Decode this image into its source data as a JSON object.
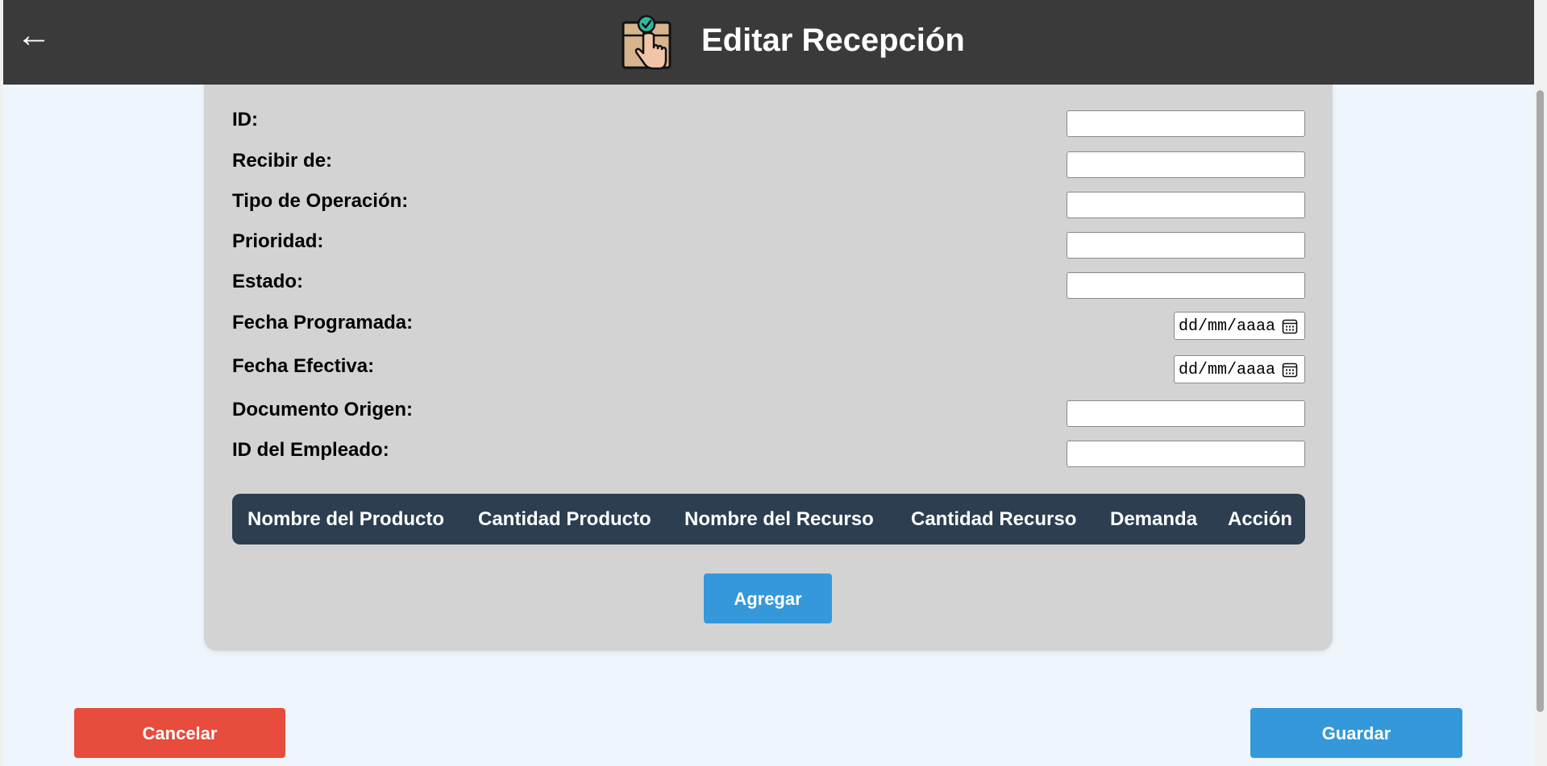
{
  "header": {
    "back_label": "←",
    "title": "Editar Recepción",
    "logo_icon": "package-pointer-icon"
  },
  "form": {
    "fields": [
      {
        "label": "ID:",
        "type": "text",
        "value": ""
      },
      {
        "label": "Recibir de:",
        "type": "text",
        "value": ""
      },
      {
        "label": "Tipo de Operación:",
        "type": "text",
        "value": ""
      },
      {
        "label": "Prioridad:",
        "type": "text",
        "value": ""
      },
      {
        "label": "Estado:",
        "type": "text",
        "value": ""
      },
      {
        "label": "Fecha Programada:",
        "type": "date",
        "placeholder": "dd/mm/aaaa"
      },
      {
        "label": "Fecha Efectiva:",
        "type": "date",
        "placeholder": "dd/mm/aaaa"
      },
      {
        "label": "Documento Origen:",
        "type": "text",
        "value": ""
      },
      {
        "label": "ID del Empleado:",
        "type": "text",
        "value": ""
      }
    ]
  },
  "table": {
    "columns": [
      "Nombre del Producto",
      "Cantidad Producto",
      "Nombre del Recurso",
      "Cantidad Recurso",
      "Demanda",
      "Acción"
    ],
    "rows": []
  },
  "buttons": {
    "add": "Agregar",
    "cancel": "Cancelar",
    "save": "Guardar"
  },
  "colors": {
    "header_bg": "#3a3a3a",
    "page_bg": "#eef5fc",
    "card_bg": "#d3d3d3",
    "table_header_bg": "#2c3e50",
    "primary": "#3498db",
    "danger": "#e74c3c"
  }
}
